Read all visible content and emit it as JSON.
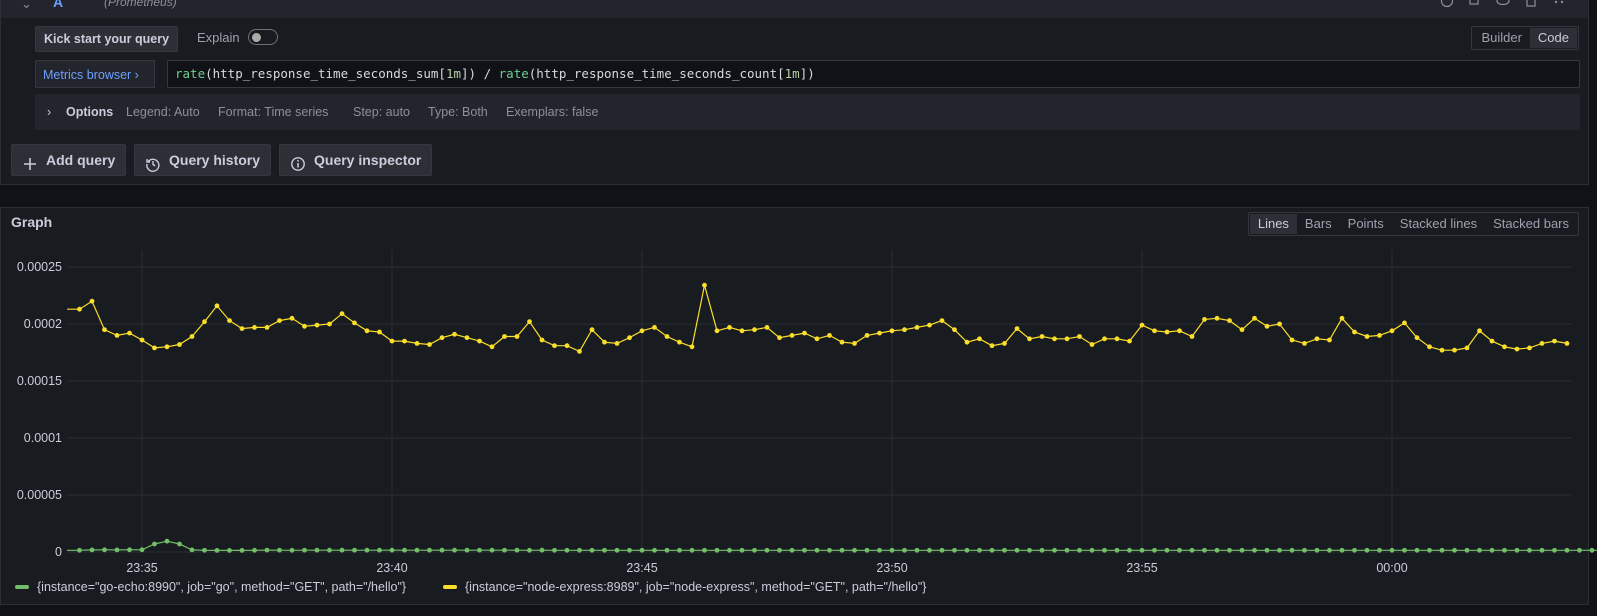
{
  "query_row": {
    "letter": "A",
    "datasource": "(Prometheus)",
    "kickstart_label": "Kick start your query",
    "explain_label": "Explain",
    "explain_enabled": false,
    "modes": [
      "Builder",
      "Code"
    ],
    "active_mode": "Code",
    "metrics_browser_label": "Metrics browser ›",
    "query": "rate(http_response_time_seconds_sum[1m]) / rate(http_response_time_seconds_count[1m])",
    "options_label": "Options",
    "options": {
      "legend": "Legend: Auto",
      "format": "Format: Time series",
      "step": "Step: auto",
      "type": "Type: Both",
      "exemplars": "Exemplars: false"
    }
  },
  "actions": {
    "add_query": "Add query",
    "query_history": "Query history",
    "query_inspector": "Query inspector"
  },
  "graph": {
    "title": "Graph",
    "viz_options": [
      "Lines",
      "Bars",
      "Points",
      "Stacked lines",
      "Stacked bars"
    ],
    "active_viz": "Lines"
  },
  "colors": {
    "series_green": "#73bf69",
    "series_yellow": "#fade2a",
    "accent_blue": "#6e9fff"
  },
  "chart_data": {
    "type": "line",
    "x_unit": "time (HH:MM)",
    "x_ticks": [
      "23:35",
      "23:40",
      "23:45",
      "23:50",
      "23:55",
      "00:00"
    ],
    "x_range_minutes": [
      -1.5,
      28.6
    ],
    "step_minutes": 0.25,
    "y_ticks": [
      "0",
      "0.00005",
      "0.0001",
      "0.00015",
      "0.0002",
      "0.00025"
    ],
    "ylim": [
      0,
      0.00025
    ],
    "grid": true,
    "legend_position": "bottom-left",
    "series": [
      {
        "name": "{instance=\"go-echo:8990\", job=\"go\", method=\"GET\", path=\"/hello\"}",
        "color": "#73bf69",
        "values": [
          1.5e-06,
          1.8e-06,
          1.9e-06,
          1.8e-06,
          1.9e-06,
          1.9e-06,
          7e-06,
          9.5e-06,
          7e-06,
          1.8e-06,
          1.5e-06,
          1.4e-06,
          1.4e-06,
          1.4e-06,
          1.5e-06,
          1.7e-06,
          1.6e-06,
          1.5e-06,
          1.6e-06,
          1.6e-06,
          1.6e-06,
          1.6e-06,
          1.6e-06,
          1.6e-06,
          1.6e-06,
          1.6e-06,
          1.6e-06,
          1.6e-06,
          1.6e-06,
          1.6e-06,
          1.6e-06,
          1.6e-06,
          1.6e-06,
          1.6e-06,
          1.6e-06,
          1.6e-06,
          1.5e-06,
          1.6e-06,
          1.5e-06,
          1.5e-06,
          1.5e-06,
          1.5e-06,
          1.5e-06,
          1.5e-06,
          1.5e-06,
          1.5e-06,
          1.5e-06,
          1.5e-06,
          1.5e-06,
          1.5e-06,
          1.5e-06,
          1.5e-06,
          1.5e-06,
          1.5e-06,
          1.5e-06,
          1.5e-06,
          1.5e-06,
          1.5e-06,
          1.5e-06,
          1.5e-06,
          1.5e-06,
          1.5e-06,
          1.5e-06,
          1.5e-06,
          1.5e-06,
          1.5e-06,
          1.5e-06,
          1.5e-06,
          1.5e-06,
          1.5e-06,
          1.5e-06,
          1.5e-06,
          1.5e-06,
          1.5e-06,
          1.5e-06,
          1.5e-06,
          1.5e-06,
          1.5e-06,
          1.5e-06,
          1.5e-06,
          1.5e-06,
          1.5e-06,
          1.5e-06,
          1.5e-06,
          1.5e-06,
          1.5e-06,
          1.5e-06,
          1.5e-06,
          1.5e-06,
          1.5e-06,
          1.5e-06,
          1.5e-06,
          1.5e-06,
          1.5e-06,
          1.5e-06,
          1.5e-06,
          1.5e-06,
          1.5e-06,
          1.5e-06,
          1.5e-06,
          1.5e-06,
          1.5e-06,
          1.5e-06,
          1.5e-06,
          1.5e-06,
          1.5e-06,
          1.5e-06,
          1.5e-06,
          1.5e-06,
          1.5e-06,
          1.5e-06,
          1.5e-06,
          1.5e-06,
          1.5e-06,
          1.5e-06,
          1.5e-06,
          1.5e-06,
          1.5e-06,
          1.5e-06,
          1.5e-06,
          1.5e-06,
          1.5e-06,
          1.5e-06,
          1.5e-06,
          1.5e-06,
          1.5e-06,
          1.5e-06,
          1.5e-06
        ]
      },
      {
        "name": "{instance=\"node-express:8989\", job=\"node-express\", method=\"GET\", path=\"/hello\"}",
        "color": "#fade2a",
        "values": [
          0.000213,
          0.00022,
          0.000195,
          0.00019,
          0.000192,
          0.000186,
          0.000179,
          0.00018,
          0.000182,
          0.000189,
          0.000202,
          0.000216,
          0.000203,
          0.000196,
          0.000197,
          0.000197,
          0.000203,
          0.000205,
          0.000198,
          0.000199,
          0.0002,
          0.000209,
          0.000201,
          0.000194,
          0.000193,
          0.000185,
          0.000185,
          0.000183,
          0.000182,
          0.000188,
          0.000191,
          0.000188,
          0.000185,
          0.00018,
          0.000189,
          0.000189,
          0.000202,
          0.000186,
          0.000181,
          0.000181,
          0.000176,
          0.000195,
          0.000184,
          0.000183,
          0.000188,
          0.000194,
          0.000197,
          0.000189,
          0.000184,
          0.00018,
          0.000234,
          0.000194,
          0.000197,
          0.000194,
          0.000195,
          0.000197,
          0.000188,
          0.00019,
          0.000192,
          0.000187,
          0.00019,
          0.000184,
          0.000183,
          0.00019,
          0.000192,
          0.000194,
          0.000195,
          0.000197,
          0.000199,
          0.000203,
          0.000195,
          0.000184,
          0.000187,
          0.000181,
          0.000183,
          0.000196,
          0.000187,
          0.000189,
          0.000187,
          0.000187,
          0.000189,
          0.000182,
          0.000187,
          0.000187,
          0.000185,
          0.000199,
          0.000194,
          0.000193,
          0.000194,
          0.000189,
          0.000204,
          0.000205,
          0.000203,
          0.000195,
          0.000205,
          0.000198,
          0.0002,
          0.000186,
          0.000183,
          0.000187,
          0.000186,
          0.000205,
          0.000193,
          0.000189,
          0.00019,
          0.000194,
          0.000201,
          0.000188,
          0.00018,
          0.000177,
          0.000177,
          0.000179,
          0.000194,
          0.000185,
          0.00018,
          0.000178,
          0.000179,
          0.000183,
          0.000185,
          0.000183
        ]
      }
    ]
  }
}
